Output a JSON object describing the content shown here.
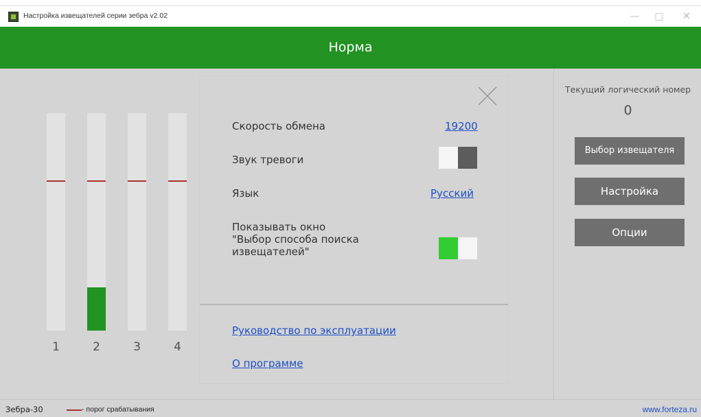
{
  "window": {
    "title": "Настройка извещателей серии зебра v2.02",
    "minimize_icon": "minimize-icon",
    "maximize_icon": "maximize-icon",
    "close_icon": "close-icon"
  },
  "status": {
    "text": "Норма",
    "color": "#229222"
  },
  "meters": [
    {
      "label": "1",
      "level": 0.0,
      "threshold": 0.69
    },
    {
      "label": "2",
      "level": 0.2,
      "threshold": 0.69
    },
    {
      "label": "3",
      "level": 0.0,
      "threshold": 0.69
    },
    {
      "label": "4",
      "level": 0.0,
      "threshold": 0.69
    }
  ],
  "right_panel": {
    "logical_number_label": "Текущий логический номер",
    "logical_number_value": "0",
    "select_detector_button": "Выбор извещателя",
    "settings_button": "Настройка",
    "options_button": "Опции"
  },
  "footer": {
    "device_name": "Зебра-30",
    "legend_text": "- порог срабатывания",
    "site_link": "www.forteza.ru"
  },
  "options_dialog": {
    "baud_rate_label": "Скорость обмена",
    "baud_rate_value": "19200",
    "alarm_sound_label": "Звук тревоги",
    "alarm_sound_on": false,
    "language_label": "Язык",
    "language_value": "Русский",
    "show_search_window_label_line1": "Показывать окно",
    "show_search_window_label_line2": "\"Выбор способа поиска",
    "show_search_window_label_line3": "извещателей\"",
    "show_search_window_on": true,
    "manual_link": "Руководство по эксплуатации",
    "about_link": "О программе"
  },
  "colors": {
    "accent_green": "#229222",
    "toggle_on": "#33cc33",
    "toggle_off": "#5c5c5c",
    "threshold_red": "#a83232",
    "link_blue": "#1c4fc4"
  }
}
